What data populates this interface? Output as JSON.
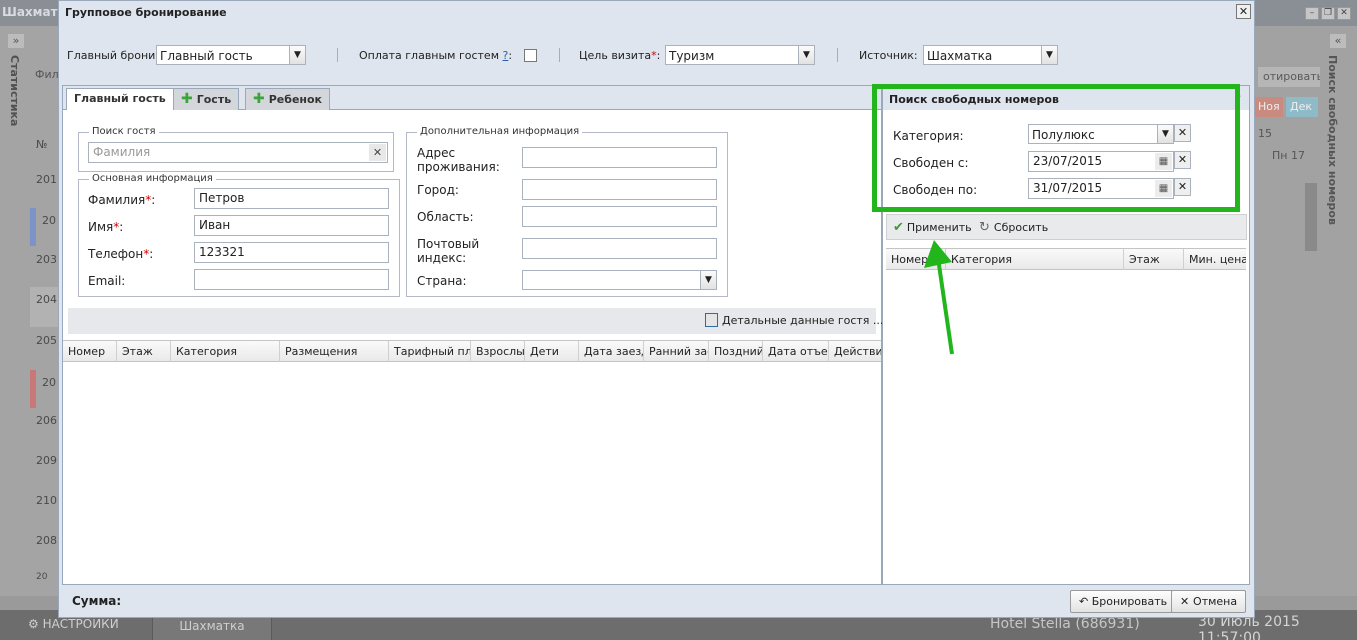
{
  "background": {
    "window_title": "Шахматка",
    "left_sidebar_label": "Статистика",
    "filter_text": "Фил",
    "rows": [
      "№",
      "201",
      "20",
      "203",
      "204",
      "205",
      "20",
      "206",
      "209",
      "210",
      "208",
      "20"
    ],
    "right_sidebar_label": "Поиск свободных номеров",
    "right_button": "отировать бр",
    "month_nov": "Ноя",
    "month_dec": "Дек",
    "day_15": "15",
    "day_pn17": "Пн 17",
    "taskbar_settings": "НАСТРОЙКИ",
    "taskbar_chess": "Шахматка",
    "hotel": "Hotel Stella (686931)",
    "datetime": "30 Июль 2015 11:57:00"
  },
  "dialog": {
    "title": "Групповое бронирование",
    "close": "✕",
    "top": {
      "main_booking_label": "Главный брони",
      "main_booking_value": "Главный гость",
      "payment_label": "Оплата главным гостем",
      "payment_q": "?",
      "payment_colon": ":",
      "visit_label": "Цель визита",
      "visit_value": "Туризм",
      "source_label": "Источник:",
      "source_value": "Шахматка"
    },
    "tabs": [
      "Главный гость",
      "Гость",
      "Ребенок"
    ],
    "guest_search": {
      "legend": "Поиск гостя",
      "placeholder": "Фамилия"
    },
    "main_info": {
      "legend": "Основная информация",
      "surname_label": "Фамилия",
      "surname": "Петров",
      "name_label": "Имя",
      "name": "Иван",
      "phone_label": "Телефон",
      "phone": "123321",
      "email_label": "Email:",
      "email": ""
    },
    "extra_info": {
      "legend": "Дополнительная информация",
      "address_label": "Адрес проживания:",
      "city_label": "Город:",
      "region_label": "Область:",
      "zip_label": "Почтовый индекс:",
      "country_label": "Страна:"
    },
    "details_button": "Детальные данные гостя ...",
    "grid_columns": [
      "Номер",
      "Этаж",
      "Категория",
      "Размещения",
      "Тарифный план",
      "Взрослые",
      "Дети",
      "Дата заезда",
      "Ранний заезд",
      "Поздний отъезд",
      "Дата отъезда",
      "Действия"
    ],
    "sum_label": "Сумма:",
    "book_button": "Бронировать",
    "cancel_button": "Отмена"
  },
  "search_panel": {
    "title": "Поиск свободных номеров",
    "category_label": "Категория:",
    "category_value": "Полулюкс",
    "from_label": "Свободен с:",
    "from_value": "23/07/2015",
    "to_label": "Свободен по:",
    "to_value": "31/07/2015",
    "apply": "Применить",
    "reset": "Сбросить",
    "columns": [
      "Номер",
      "Категория",
      "Этаж",
      "Мин. цена"
    ]
  },
  "colors": {
    "highlight_green": "#22b51c",
    "required_red": "#d10000"
  }
}
